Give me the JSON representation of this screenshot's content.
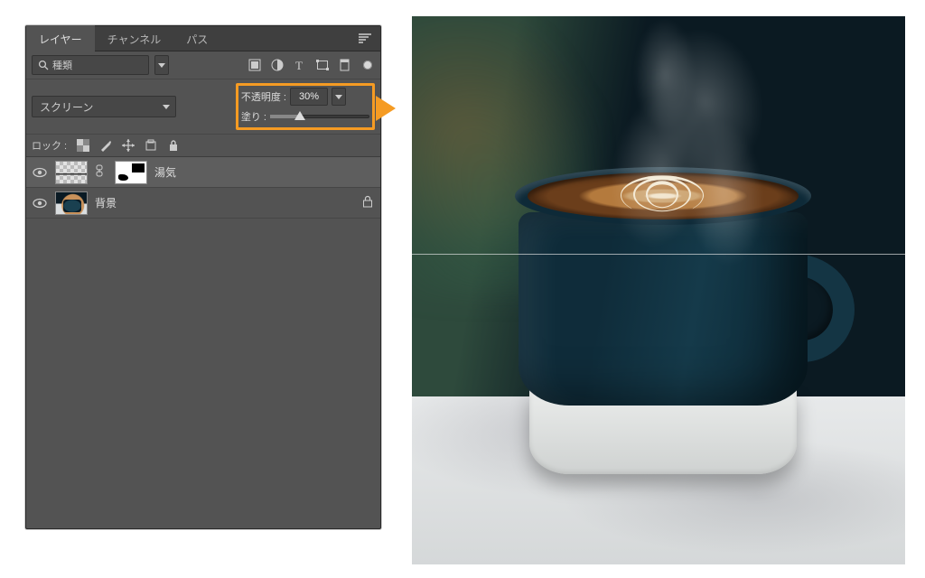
{
  "tabs": {
    "layers": "レイヤー",
    "channels": "チャンネル",
    "paths": "パス"
  },
  "filter": {
    "kind": "種類"
  },
  "blend": {
    "mode": "スクリーン"
  },
  "opacity": {
    "label": "不透明度 :",
    "value": "30%",
    "percent": 30
  },
  "fill": {
    "label": "塗り :"
  },
  "lock": {
    "label": "ロック :"
  },
  "layers": [
    {
      "name": "湯気",
      "selected": true,
      "locked": false,
      "hasMask": true,
      "visible": true
    },
    {
      "name": "背景",
      "selected": false,
      "locked": true,
      "hasMask": false,
      "visible": true
    }
  ]
}
